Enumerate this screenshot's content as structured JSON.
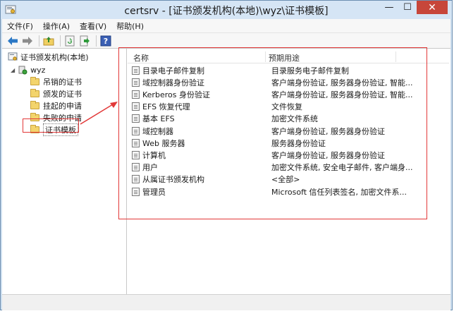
{
  "window": {
    "title": "certsrv - [证书颁发机构(本地)\\wyz\\证书模板]"
  },
  "menu": [
    "文件(F)",
    "操作(A)",
    "查看(V)",
    "帮助(H)"
  ],
  "toolbar": {
    "icons": [
      "back-arrow-icon",
      "forward-arrow-icon",
      "up-folder-icon",
      "refresh-icon",
      "export-icon",
      "help-icon"
    ],
    "help_glyph": "?"
  },
  "tree": {
    "root": "证书颁发机构(本地)",
    "ca": "wyz",
    "items": [
      "吊销的证书",
      "颁发的证书",
      "挂起的申请",
      "失败的申请",
      "证书模板"
    ],
    "selected": "证书模板"
  },
  "list": {
    "columns": [
      "名称",
      "预期用途"
    ],
    "rows": [
      {
        "name": "目录电子邮件复制",
        "purpose": "目录服务电子邮件复制"
      },
      {
        "name": "域控制器身份验证",
        "purpose": "客户端身份验证, 服务器身份验证, 智能..."
      },
      {
        "name": "Kerberos 身份验证",
        "purpose": "客户端身份验证, 服务器身份验证, 智能..."
      },
      {
        "name": "EFS 恢复代理",
        "purpose": "文件恢复"
      },
      {
        "name": "基本 EFS",
        "purpose": "加密文件系统"
      },
      {
        "name": "域控制器",
        "purpose": "客户端身份验证, 服务器身份验证"
      },
      {
        "name": "Web 服务器",
        "purpose": "服务器身份验证"
      },
      {
        "name": "计算机",
        "purpose": "客户端身份验证, 服务器身份验证"
      },
      {
        "name": "用户",
        "purpose": "加密文件系统, 安全电子邮件, 客户端身..."
      },
      {
        "name": "从属证书颁发机构",
        "purpose": "<全部>"
      },
      {
        "name": "管理员",
        "purpose": "Microsoft 信任列表签名, 加密文件系..."
      }
    ]
  },
  "colors": {
    "annotation": "#e23838",
    "titlebar": "#d5e5f5",
    "close": "#c7463a"
  }
}
